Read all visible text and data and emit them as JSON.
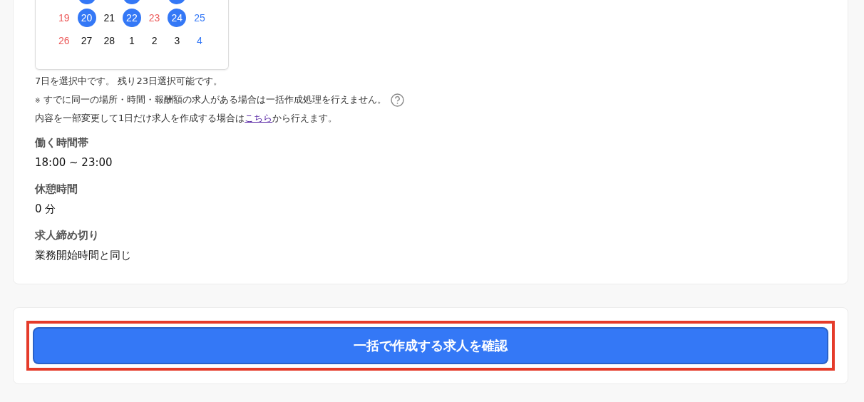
{
  "calendar": {
    "cut_row": [
      {
        "selected": false
      },
      {
        "selected": true
      },
      {
        "selected": false
      },
      {
        "selected": true
      },
      {
        "selected": false
      },
      {
        "selected": true
      },
      {
        "selected": false
      }
    ],
    "rows": [
      [
        {
          "label": "19",
          "color": "#ec5a5a",
          "selected": false
        },
        {
          "label": "20",
          "selected": true
        },
        {
          "label": "21",
          "color": "#111111",
          "selected": false
        },
        {
          "label": "22",
          "selected": true
        },
        {
          "label": "23",
          "color": "#ec5a5a",
          "selected": false
        },
        {
          "label": "24",
          "selected": true
        },
        {
          "label": "25",
          "color": "#3478f6",
          "selected": false
        }
      ],
      [
        {
          "label": "26",
          "color": "#ec5a5a",
          "selected": false
        },
        {
          "label": "27",
          "color": "#111111",
          "selected": false
        },
        {
          "label": "28",
          "color": "#111111",
          "selected": false
        },
        {
          "label": "1",
          "color": "#111111",
          "selected": false
        },
        {
          "label": "2",
          "color": "#111111",
          "selected": false
        },
        {
          "label": "3",
          "color": "#111111",
          "selected": false
        },
        {
          "label": "4",
          "color": "#3478f6",
          "selected": false
        }
      ]
    ]
  },
  "selection_status": "7日を選択中です。 残り23日選択可能です。",
  "notice": {
    "mark": "※",
    "text": "すでに同一の場所・時間・報酬額の求人がある場合は一括作成処理を行えません。"
  },
  "single_create_note": {
    "before": "内容を一部変更して1日だけ求人を作成する場合は",
    "link": "こちら",
    "after": "から行えます。"
  },
  "fields": [
    {
      "label": "働く時間帯",
      "value": "18:00 ~ 23:00"
    },
    {
      "label": "休憩時間",
      "value": "0 分"
    },
    {
      "label": "求人締め切り",
      "value": "業務開始時間と同じ"
    }
  ],
  "confirm_button": {
    "label": "一括で作成する求人を確認",
    "highlighted": true
  }
}
